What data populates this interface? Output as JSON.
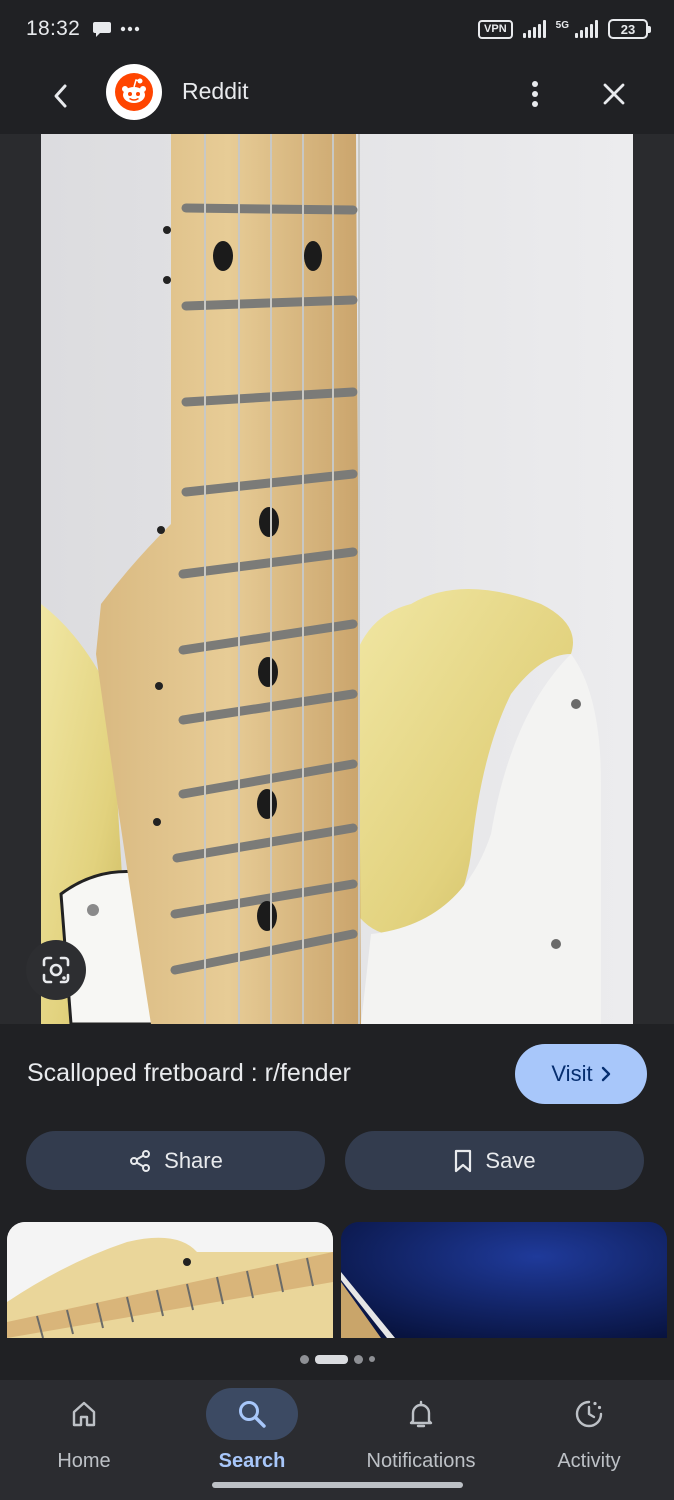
{
  "status_bar": {
    "time": "18:32",
    "left_icons": [
      "chat-bubble-icon",
      "more-dots-icon"
    ],
    "vpn": "VPN",
    "network": "5G",
    "battery": "23"
  },
  "top_bar": {
    "site_name": "Reddit",
    "icons": {
      "back": "chevron-left-icon",
      "more": "more-vertical-icon",
      "close": "close-icon",
      "logo": "reddit-logo"
    }
  },
  "result": {
    "title": "Scalloped fretboard : r/fender",
    "visit_label": "Visit"
  },
  "actions": {
    "share_label": "Share",
    "save_label": "Save"
  },
  "pager": {
    "count": 4,
    "active_index": 1
  },
  "bottom_nav": {
    "items": [
      {
        "label": "Home",
        "icon": "home-icon"
      },
      {
        "label": "Search",
        "icon": "search-icon",
        "active": true
      },
      {
        "label": "Notifications",
        "icon": "bell-icon"
      },
      {
        "label": "Activity",
        "icon": "activity-icon"
      }
    ]
  },
  "colors": {
    "background": "#202124",
    "accent": "#a8c7fa",
    "button_bg": "#333c4e",
    "reddit_orange": "#ff4500"
  }
}
